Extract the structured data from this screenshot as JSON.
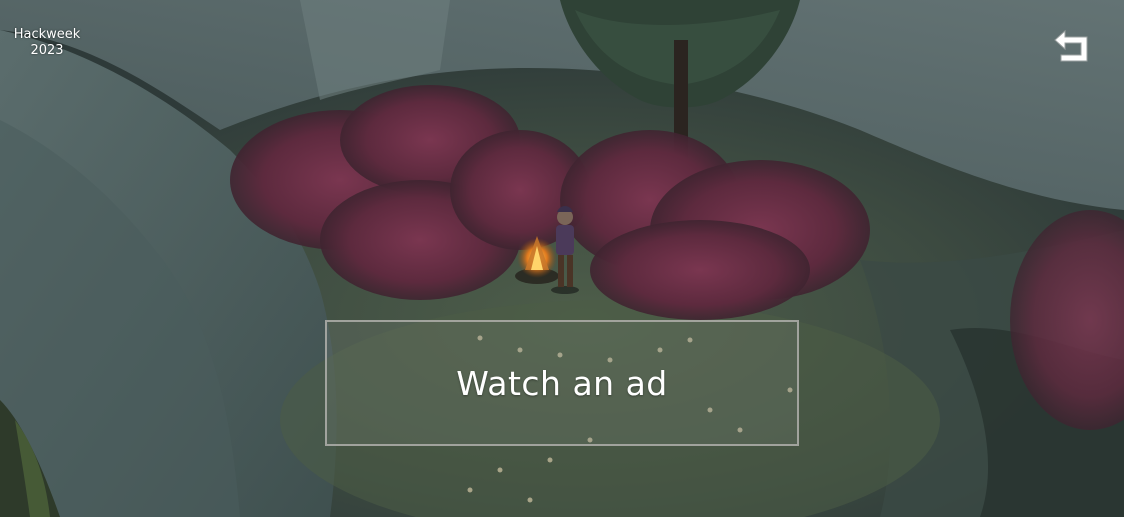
{
  "watermark": {
    "line1": "Hackweek",
    "line2": "2023"
  },
  "back_button": {
    "icon": "return-arrow-icon"
  },
  "ad_button": {
    "label": "Watch an ad"
  },
  "colors": {
    "rock": "#4f6160",
    "grass": "#3c4b3a",
    "foliage": "#6e3048",
    "button_border": "#afafaa",
    "text": "#ffffff"
  }
}
